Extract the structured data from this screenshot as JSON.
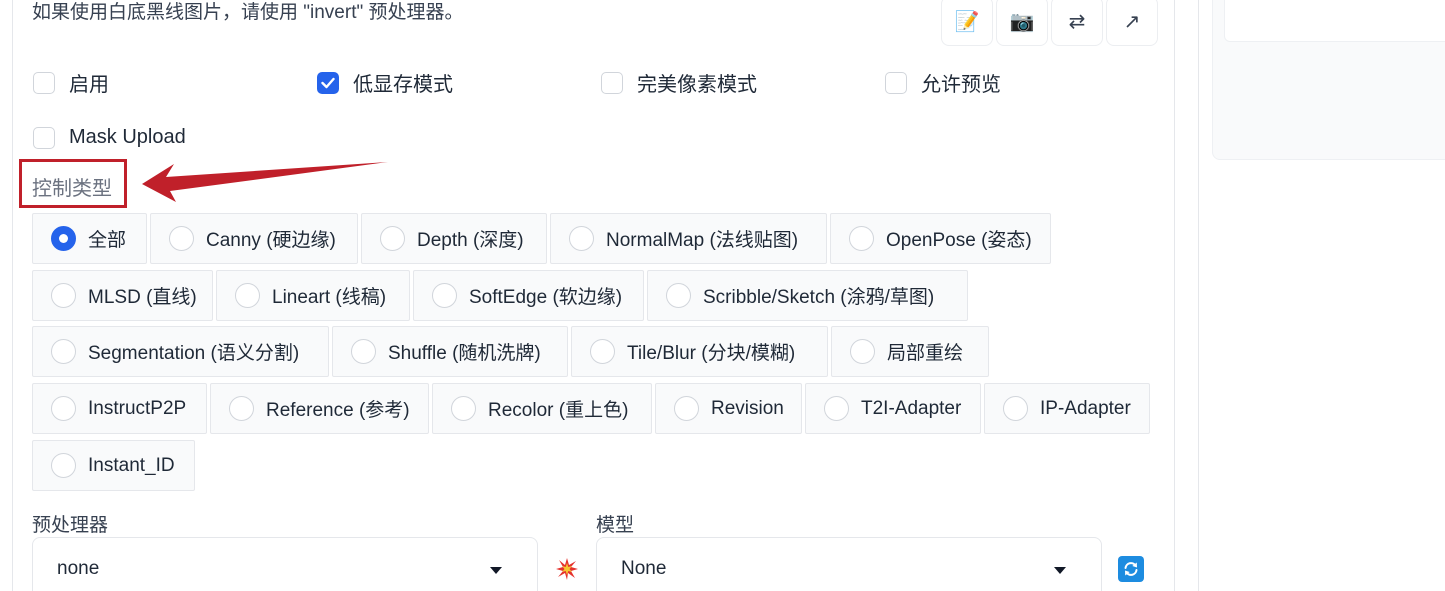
{
  "hint_text": "如果使用白底黑线图片，请使用 \"invert\" 预处理器。",
  "toolbar": [
    {
      "name": "edit-icon",
      "glyph": "📝"
    },
    {
      "name": "camera-icon",
      "glyph": "📷"
    },
    {
      "name": "swap-icon",
      "glyph": "⇄"
    },
    {
      "name": "send-icon",
      "glyph": "↗"
    }
  ],
  "checkboxes": {
    "enable": {
      "label": "启用",
      "checked": false
    },
    "low_vram": {
      "label": "低显存模式",
      "checked": true
    },
    "pixel_perfect": {
      "label": "完美像素模式",
      "checked": false
    },
    "allow_preview": {
      "label": "允许预览",
      "checked": false
    },
    "mask_upload": {
      "label": "Mask Upload",
      "checked": false
    }
  },
  "control_type": {
    "label": "控制类型",
    "selected": "全部",
    "options": [
      "全部",
      "Canny (硬边缘)",
      "Depth (深度)",
      "NormalMap (法线贴图)",
      "OpenPose (姿态)",
      "MLSD (直线)",
      "Lineart (线稿)",
      "SoftEdge (软边缘)",
      "Scribble/Sketch (涂鸦/草图)",
      "Segmentation (语义分割)",
      "Shuffle (随机洗牌)",
      "Tile/Blur (分块/模糊)",
      "局部重绘",
      "InstructP2P",
      "Reference (参考)",
      "Recolor (重上色)",
      "Revision",
      "T2I-Adapter",
      "IP-Adapter",
      "Instant_ID"
    ]
  },
  "preprocessor": {
    "label": "预处理器",
    "value": "none"
  },
  "model": {
    "label": "模型",
    "value": "None"
  },
  "colors": {
    "accent": "#2563eb",
    "annotation": "#c0202a"
  }
}
